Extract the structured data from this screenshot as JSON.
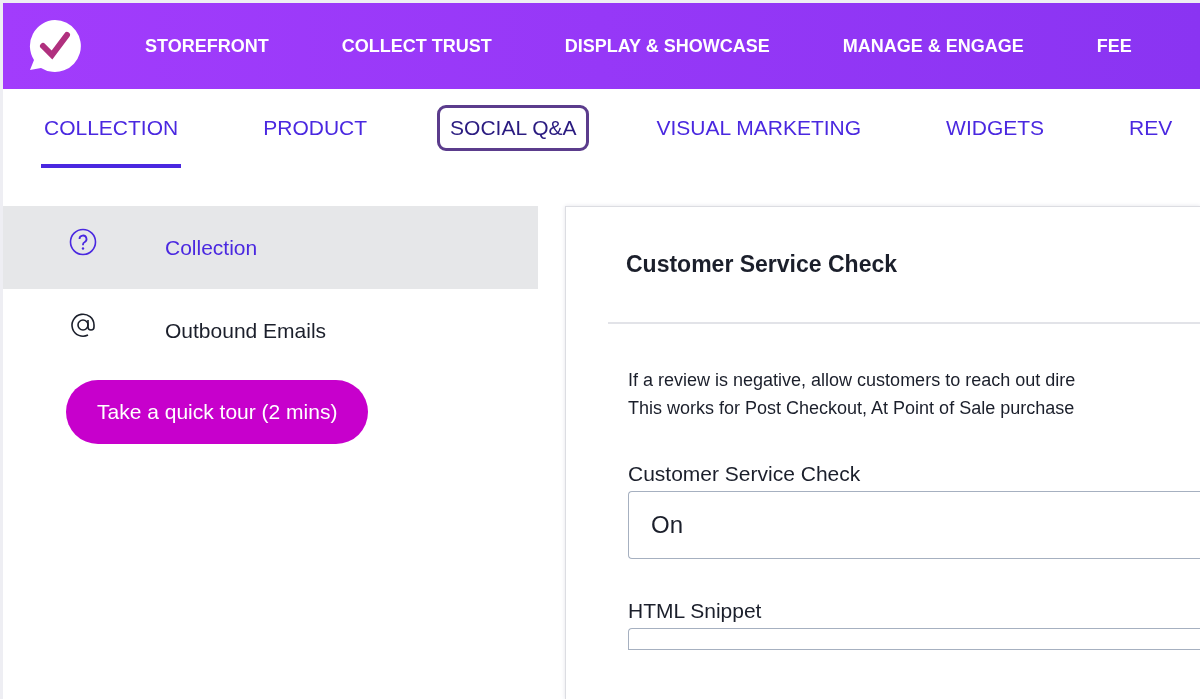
{
  "top_nav": [
    {
      "label": "STOREFRONT"
    },
    {
      "label": "COLLECT TRUST"
    },
    {
      "label": "DISPLAY & SHOWCASE"
    },
    {
      "label": "MANAGE & ENGAGE"
    },
    {
      "label": "FEE"
    }
  ],
  "tabs": [
    {
      "label": "COLLECTION",
      "selected": true,
      "focused": false
    },
    {
      "label": "PRODUCT",
      "selected": false,
      "focused": false
    },
    {
      "label": "SOCIAL Q&A",
      "selected": false,
      "focused": true
    },
    {
      "label": "VISUAL MARKETING",
      "selected": false,
      "focused": false
    },
    {
      "label": "WIDGETS",
      "selected": false,
      "focused": false
    },
    {
      "label": "REV",
      "selected": false,
      "focused": false
    }
  ],
  "sidebar": {
    "items": [
      {
        "label": "Collection",
        "selected": true
      },
      {
        "label": "Outbound Emails",
        "selected": false
      }
    ],
    "tour_button": "Take a quick tour (2 mins)"
  },
  "panel": {
    "title": "Customer Service Check",
    "description": [
      "If a review is negative, allow customers to reach out dire",
      "This works for Post Checkout, At Point of Sale purchase"
    ],
    "fields": [
      {
        "label": "Customer Service Check",
        "value": "On"
      },
      {
        "label": "HTML Snippet"
      }
    ]
  }
}
